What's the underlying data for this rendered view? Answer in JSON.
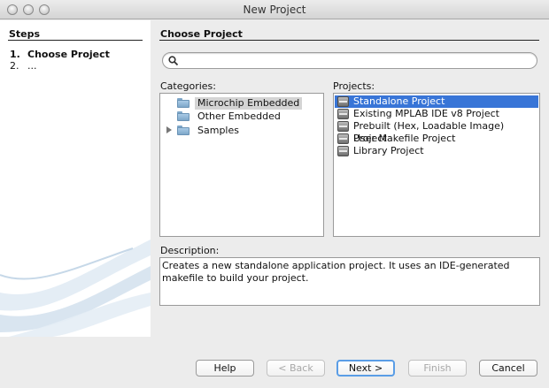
{
  "window": {
    "title": "New Project"
  },
  "steps": {
    "heading": "Steps",
    "items": [
      {
        "num": "1.",
        "label": "Choose Project"
      },
      {
        "num": "2.",
        "label": "..."
      }
    ]
  },
  "main": {
    "heading": "Choose Project",
    "search": {
      "value": "",
      "placeholder": ""
    },
    "categories": {
      "label": "Categories:",
      "items": [
        {
          "label": "Microchip Embedded",
          "selected": true,
          "expandable": false
        },
        {
          "label": "Other Embedded",
          "selected": false,
          "expandable": false
        },
        {
          "label": "Samples",
          "selected": false,
          "expandable": true
        }
      ]
    },
    "projects": {
      "label": "Projects:",
      "items": [
        {
          "label": "Standalone Project",
          "selected": true
        },
        {
          "label": "Existing MPLAB IDE v8 Project",
          "selected": false
        },
        {
          "label": "Prebuilt (Hex, Loadable Image) Project",
          "selected": false
        },
        {
          "label": "User Makefile Project",
          "selected": false
        },
        {
          "label": "Library Project",
          "selected": false
        }
      ]
    },
    "description": {
      "label": "Description:",
      "text": "Creates a new standalone application project. It uses an IDE-generated makefile to build your project."
    }
  },
  "buttons": {
    "help": "Help",
    "back": "< Back",
    "next": "Next >",
    "finish": "Finish",
    "cancel": "Cancel"
  },
  "colors": {
    "selection": "#3875d7",
    "default_button_ring": "#5a9de6"
  }
}
